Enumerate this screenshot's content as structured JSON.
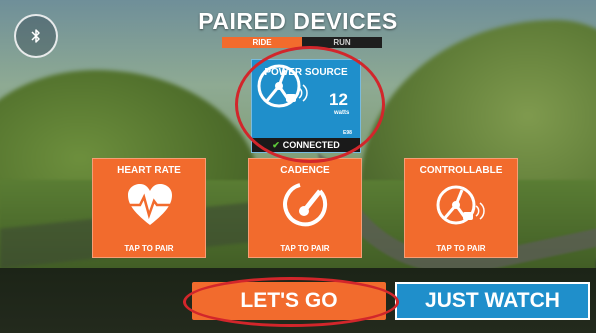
{
  "colors": {
    "accent_orange": "#f26b2d",
    "accent_blue": "#1f8fcb",
    "connected_green": "#5ecb3a",
    "annotation_red": "#d2262b"
  },
  "header": {
    "title": "PAIRED DEVICES",
    "bluetooth_icon": "bluetooth-icon"
  },
  "tabs": [
    {
      "label": "RIDE",
      "active": true
    },
    {
      "label": "RUN",
      "active": false
    }
  ],
  "power_source": {
    "title": "POWER SOURCE",
    "icon": "power-meter-icon",
    "value": "12",
    "unit": "watts",
    "device_id": "E98",
    "status": "CONNECTED",
    "status_icon": "check-icon"
  },
  "tiles": [
    {
      "title": "HEART RATE",
      "icon": "heart-rate-icon",
      "action": "TAP TO PAIR"
    },
    {
      "title": "CADENCE",
      "icon": "cadence-icon",
      "action": "TAP TO PAIR"
    },
    {
      "title": "CONTROLLABLE",
      "icon": "controllable-trainer-icon",
      "action": "TAP TO PAIR"
    }
  ],
  "actions": {
    "go_label": "LET'S GO",
    "watch_label": "JUST WATCH"
  }
}
